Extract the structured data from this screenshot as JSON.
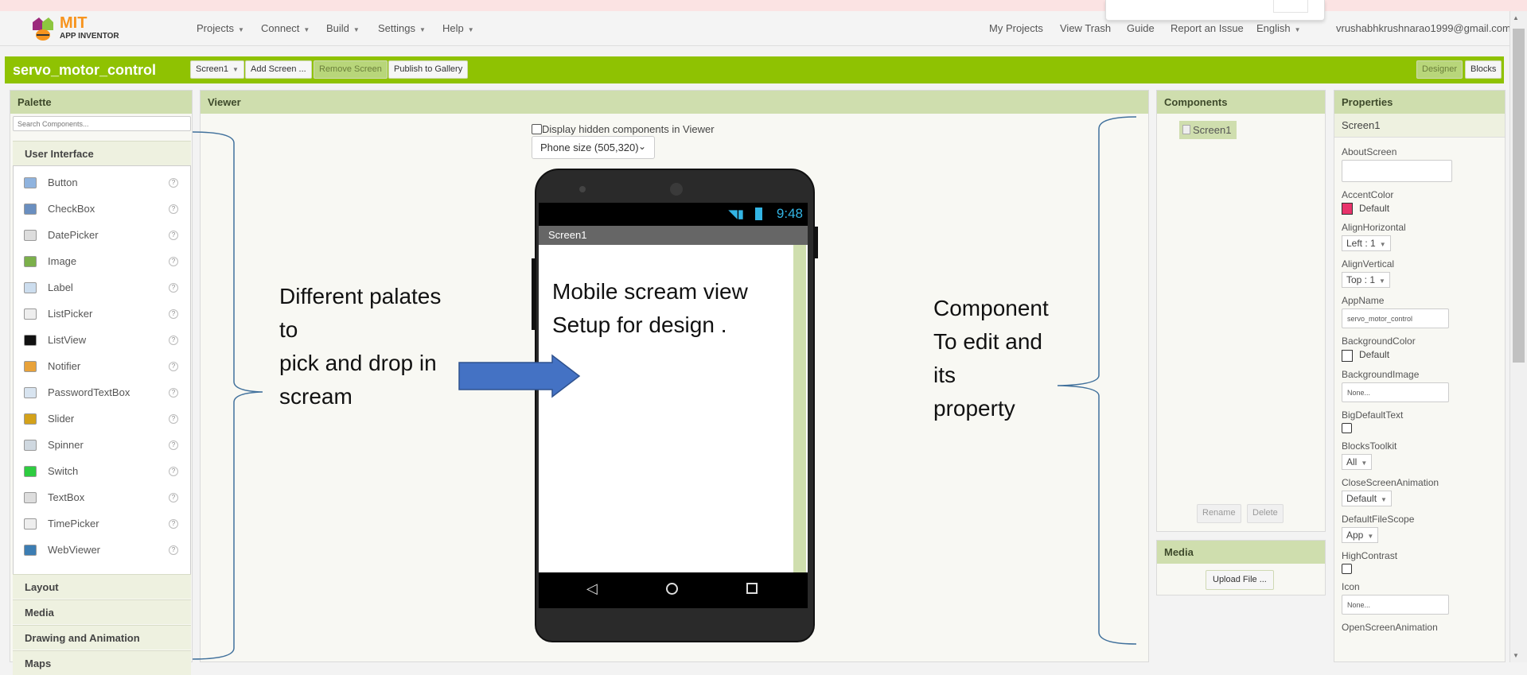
{
  "nav": {
    "brand_top": "MIT",
    "brand_bottom": "APP INVENTOR",
    "left": [
      "Projects",
      "Connect",
      "Build",
      "Settings",
      "Help"
    ],
    "right": [
      "My Projects",
      "View Trash",
      "Guide",
      "Report an Issue"
    ],
    "language": "English",
    "account": "vrushabhkrushnarao1999@gmail.com"
  },
  "toolbar": {
    "project": "servo_motor_control",
    "screen": "Screen1",
    "add_screen": "Add Screen ...",
    "remove_screen": "Remove Screen",
    "publish": "Publish to Gallery",
    "designer": "Designer",
    "blocks": "Blocks",
    "accent": "#8fc202"
  },
  "palette": {
    "title": "Palette",
    "search_placeholder": "Search Components...",
    "open_category": "User Interface",
    "items": [
      {
        "label": "Button",
        "icon": "button-icon"
      },
      {
        "label": "CheckBox",
        "icon": "checkbox-icon"
      },
      {
        "label": "DatePicker",
        "icon": "calendar-icon"
      },
      {
        "label": "Image",
        "icon": "image-icon"
      },
      {
        "label": "Label",
        "icon": "label-icon"
      },
      {
        "label": "ListPicker",
        "icon": "list-icon"
      },
      {
        "label": "ListView",
        "icon": "menu-lines-icon"
      },
      {
        "label": "Notifier",
        "icon": "warning-icon"
      },
      {
        "label": "PasswordTextBox",
        "icon": "password-icon"
      },
      {
        "label": "Slider",
        "icon": "slider-icon"
      },
      {
        "label": "Spinner",
        "icon": "spinner-icon"
      },
      {
        "label": "Switch",
        "icon": "toggle-icon"
      },
      {
        "label": "TextBox",
        "icon": "textbox-icon"
      },
      {
        "label": "TimePicker",
        "icon": "clock-icon"
      },
      {
        "label": "WebViewer",
        "icon": "globe-icon"
      }
    ],
    "help": "?",
    "categories": [
      "Layout",
      "Media",
      "Drawing and Animation",
      "Maps"
    ]
  },
  "viewer": {
    "title": "Viewer",
    "hidden_checkbox": "Display hidden components in Viewer",
    "size": "Phone size (505,320)",
    "time": "9:48",
    "screen_title": "Screen1"
  },
  "annotations": {
    "left": [
      "Different palates",
      "to",
      "pick and drop in",
      "scream"
    ],
    "middle": [
      "Mobile scream view",
      "Setup for design ."
    ],
    "right": [
      "Component",
      "To edit and",
      "its",
      "property"
    ],
    "arrow_color": "#4472c4"
  },
  "components": {
    "title": "Components",
    "tree": [
      "Screen1"
    ],
    "rename": "Rename",
    "delete": "Delete"
  },
  "media": {
    "title": "Media",
    "upload": "Upload File ..."
  },
  "properties": {
    "title": "Properties",
    "subject": "Screen1",
    "about": "AboutScreen",
    "accent": "AccentColor",
    "accent_val": "Default",
    "accent_color": "#e8336b",
    "alignh": "AlignHorizontal",
    "alignh_val": "Left : 1",
    "alignv": "AlignVertical",
    "alignv_val": "Top : 1",
    "appname": "AppName",
    "appname_val": "servo_motor_control",
    "bgcolor": "BackgroundColor",
    "bgcolor_val": "Default",
    "bgimage": "BackgroundImage",
    "bgimage_val": "None...",
    "bigtext": "BigDefaultText",
    "toolkit": "BlocksToolkit",
    "toolkit_val": "All",
    "closeanim": "CloseScreenAnimation",
    "closeanim_val": "Default",
    "filescope": "DefaultFileScope",
    "filescope_val": "App",
    "contrast": "HighContrast",
    "icon": "Icon",
    "icon_val": "None...",
    "next": "OpenScreenAnimation"
  }
}
